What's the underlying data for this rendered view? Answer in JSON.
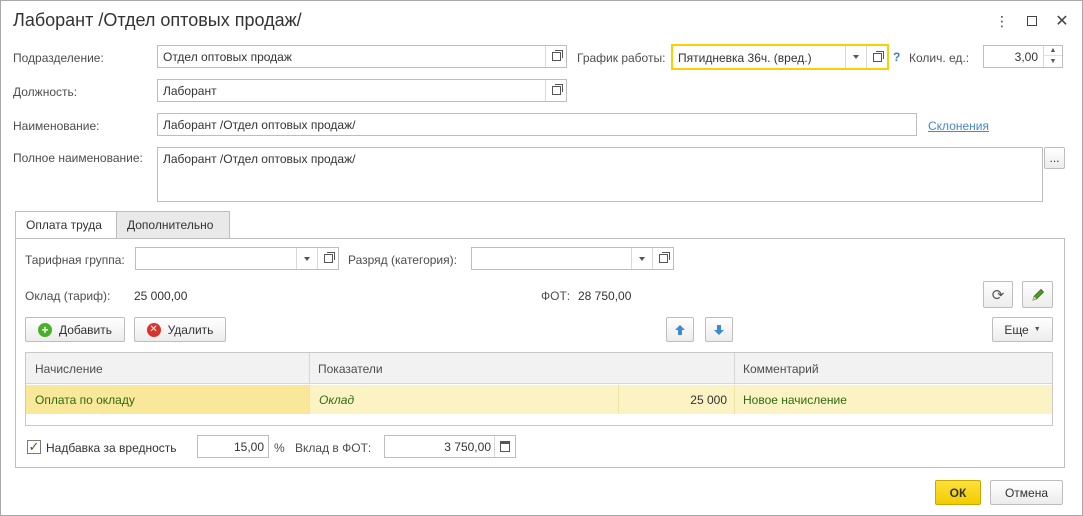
{
  "window": {
    "title": "Лаборант /Отдел оптовых продаж/",
    "menu_icon": "more-vertical-icon",
    "maximize_icon": "maximize-icon",
    "close_icon": "close-icon"
  },
  "form": {
    "subdivision_label": "Подразделение:",
    "subdivision_value": "Отдел оптовых продаж",
    "schedule_label": "График работы:",
    "schedule_value": "Пятидневка 36ч. (вред.)",
    "help_label": "?",
    "qty_label": "Колич. ед.:",
    "qty_value": "3,00",
    "position_label": "Должность:",
    "position_value": "Лаборант",
    "name_label": "Наименование:",
    "name_value": "Лаборант /Отдел оптовых продаж/",
    "declensions_link": "Склонения",
    "fullname_label": "Полное наименование:",
    "fullname_value": "Лаборант /Отдел оптовых продаж/",
    "ellipsis": "..."
  },
  "tabs": [
    {
      "label": "Оплата труда",
      "active": true
    },
    {
      "label": "Дополнительно",
      "active": false
    }
  ],
  "pay": {
    "tariff_group_label": "Тарифная группа:",
    "tariff_group_value": "",
    "grade_label": "Разряд (категория):",
    "grade_value": "",
    "salary_label": "Оклад (тариф):",
    "salary_value": "25 000,00",
    "fot_label": "ФОТ:",
    "fot_value": "28 750,00"
  },
  "toolbar": {
    "add_label": "Добавить",
    "delete_label": "Удалить",
    "more_label": "Еще"
  },
  "table": {
    "columns": [
      "Начисление",
      "Показатели",
      "Комментарий"
    ],
    "rows": [
      {
        "accrual": "Оплата по окладу",
        "indicator": "Оклад",
        "amount": "25 000",
        "comment": "Новое начисление"
      }
    ]
  },
  "bonus": {
    "checkbox_label": "Надбавка за вредность",
    "checked": true,
    "percent_value": "15,00",
    "percent_sign": "%",
    "contribution_label": "Вклад в ФОТ:",
    "contribution_value": "3 750,00"
  },
  "footer": {
    "ok_label": "ОК",
    "cancel_label": "Отмена"
  },
  "colors": {
    "accent_yellow": "#f5d300",
    "row_highlight": "#fbf3c4",
    "link": "#4a86c8",
    "green_text": "#2f6b12"
  }
}
